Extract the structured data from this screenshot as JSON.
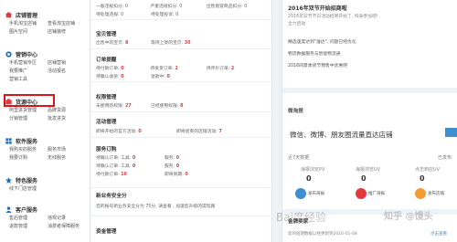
{
  "sidebar": {
    "sections": [
      {
        "title": "店铺管理",
        "icon": "store-icon",
        "icon_color": "#e4393c",
        "links": [
          "手机淘宝店铺",
          "查看淘宝店铺",
          "图片空间",
          "店铺装修"
        ]
      },
      {
        "title": "营销中心",
        "icon": "marketing-icon",
        "icon_color": "#1e73be",
        "links": [
          "手机营销专区",
          "店铺营销",
          "我要推广",
          "活动报名",
          "营销工具"
        ]
      },
      {
        "title": "货源中心",
        "icon": "resource-icon",
        "icon_color": "#e4393c",
        "links": [
          "阿里进货管理",
          "品牌货源",
          "分销管理",
          "批发进货"
        ]
      },
      {
        "title": "软件服务",
        "icon": "software-icon",
        "icon_color": "#1e73be",
        "links": [
          "我购买的服务",
          "服务市场",
          "我要订购",
          "无线服务"
        ]
      },
      {
        "title": "特色服务",
        "icon": "special-icon",
        "icon_color": "#1e73be",
        "links": [
          "线下门店管理"
        ]
      },
      {
        "title": "客户服务",
        "icon": "customer-icon",
        "icon_color": "#1e73be",
        "links": [
          "售后管理",
          "违规记录",
          "退款管理",
          "消费者保障服务"
        ]
      }
    ]
  },
  "middle": {
    "top_rows": [
      [
        "一般违规扣分: 0",
        "严重违规扣分: 0",
        "出售假冒商品扣分: 0"
      ],
      [
        "待处理违规: 0",
        "待处理投诉: 0",
        ""
      ]
    ],
    "baby": {
      "title": "宝贝管理",
      "rows": [
        [
          "出售中的宝贝: ",
          "8",
          "等待上架的宝贝: ",
          "30"
        ]
      ]
    },
    "order": {
      "title": "订单提醒",
      "rows": [
        [
          "待付款订单: ",
          "0",
          "待发货订单: ",
          "2",
          "待评价订单: ",
          "2"
        ],
        [
          "待确认收货: ",
          "0",
          "退款中: ",
          "0",
          "",
          ""
        ]
      ]
    },
    "red_packet": {
      "title": "权限管理",
      "rows": [
        [
          "未使用的权限: ",
          "27",
          "已经使用权限: ",
          "8"
        ]
      ]
    },
    "activity": {
      "title": "活动管理",
      "rows": [
        [
          "即将开始的官方活动: ",
          "0",
          "即将结束的店铺活动: ",
          "7"
        ]
      ]
    },
    "service": {
      "title": "服务订购",
      "rows": [
        [
          "待确认订单: 工具: ",
          "0",
          "服务: ",
          "0",
          "",
          ""
        ],
        [
          "待确认订单: 工具: ",
          "0",
          "服务: ",
          "0",
          "",
          ""
        ],
        [
          "待付款订单: ",
          "16",
          "即将到期: ",
          "0",
          "",
          ""
        ]
      ]
    },
    "safety": {
      "title": "新业务安全分",
      "text": "您的账号新业务安全分为 75分, 请查看 ,  加速您升级的提现路"
    },
    "funds": {
      "title": "资金管理"
    }
  },
  "right": {
    "notice_title": "2016年双节开始招商啦",
    "notice_sub1": "2016年双节节日活动招商开始了, 快来参加吧!",
    "notice_sub2": "全力启动",
    "notice_items": [
      "精选速度达到\"准达\", 问题已经优化",
      "物流数据服务与智能物流通",
      "2016同夏季货节预售中优惠吧"
    ],
    "weitao": {
      "title": "微淘报"
    },
    "promo_text": "微信、微博、朋友圈流量直达店铺",
    "period_left": "近7天数据",
    "period_right": "已发布",
    "stats": [
      {
        "label": "海报浏览PV",
        "value": "0"
      },
      {
        "label": "海报浏览UV",
        "value": "0"
      },
      {
        "label": "点击到店UV",
        "value": "0"
      }
    ],
    "actions": [
      {
        "label": "发布海报",
        "color": "#3e8ed0"
      },
      {
        "label": "推广海报",
        "color": "#e4393c"
      },
      {
        "label": "发布店铺",
        "color": "#f39c33"
      }
    ],
    "business": {
      "title": "金牌卖家",
      "text": "您的短期数据以经更新到2016-01-08",
      "link": "点击查看"
    }
  },
  "watermark": {
    "left": "Bai度经验",
    "right": "知乎 @馒头"
  }
}
